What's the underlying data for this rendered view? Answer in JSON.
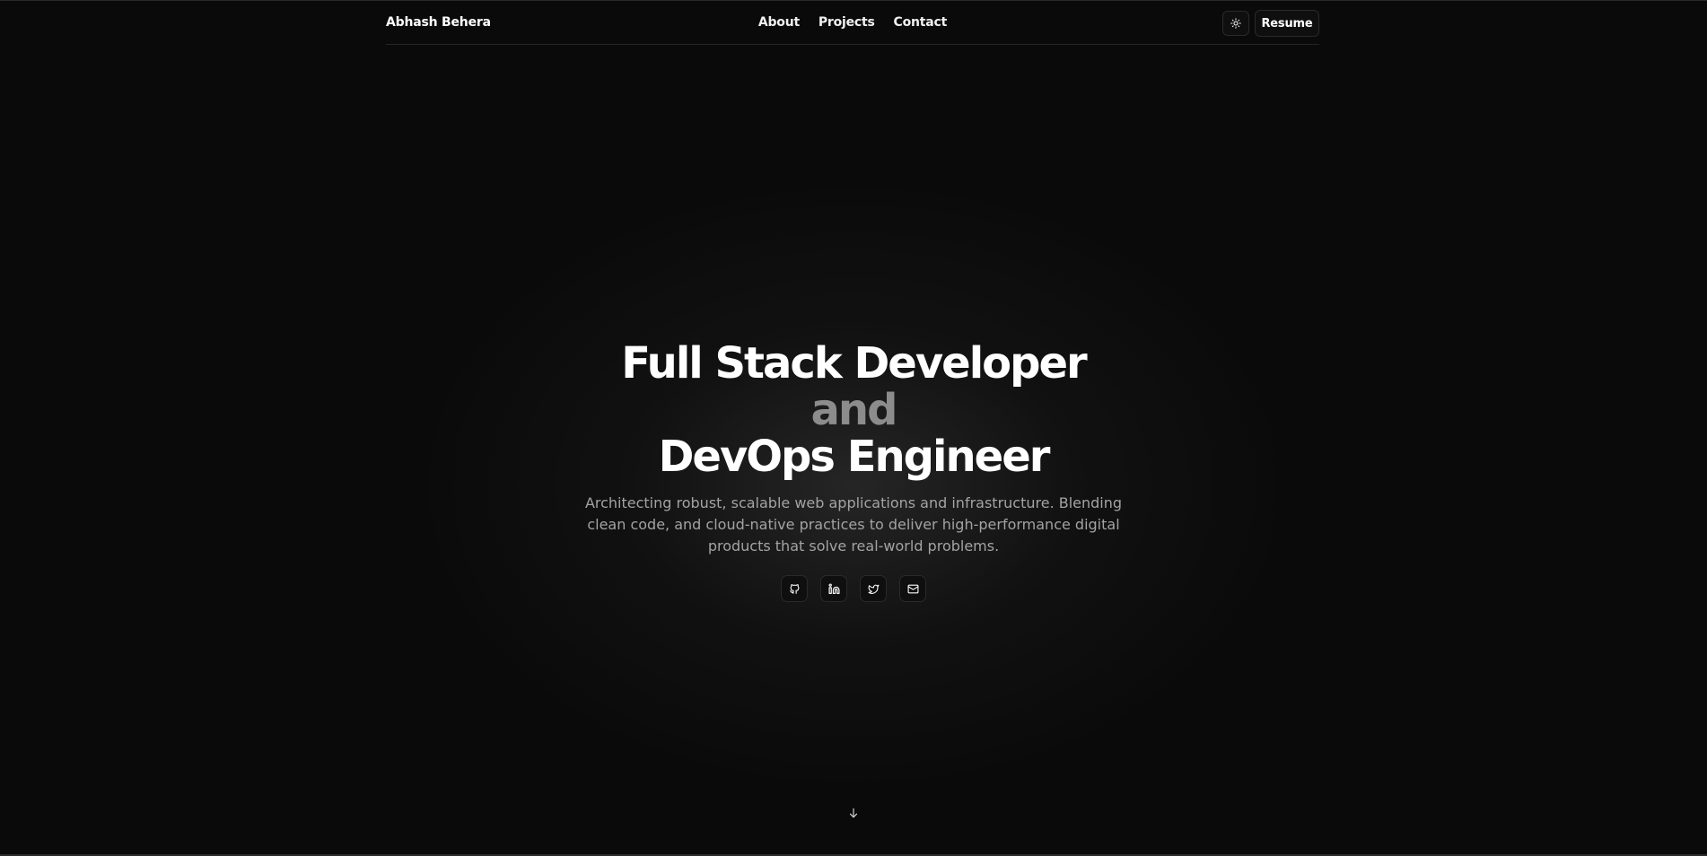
{
  "header": {
    "brand": "Abhash Behera",
    "nav": [
      "About",
      "Projects",
      "Contact"
    ],
    "theme_toggle_icon": "sun-icon",
    "resume_label": "Resume"
  },
  "hero": {
    "title_line1": "Full Stack Developer",
    "title_line2": "and",
    "title_line3": "DevOps Engineer",
    "subtitle": "Architecting robust, scalable web applications and infrastructure. Blending clean code, and cloud-native practices to deliver high-performance digital products that solve real-world problems."
  },
  "socials": [
    {
      "icon": "github-icon"
    },
    {
      "icon": "linkedin-icon"
    },
    {
      "icon": "twitter-icon"
    },
    {
      "icon": "mail-icon"
    }
  ],
  "scroll_icon": "arrow-down-icon",
  "colors": {
    "background": "#0a0a0a",
    "text_primary": "#ffffff",
    "text_muted": "#8c8c8c",
    "subtitle": "#a3a3a3",
    "border": "#2a2a2a"
  }
}
